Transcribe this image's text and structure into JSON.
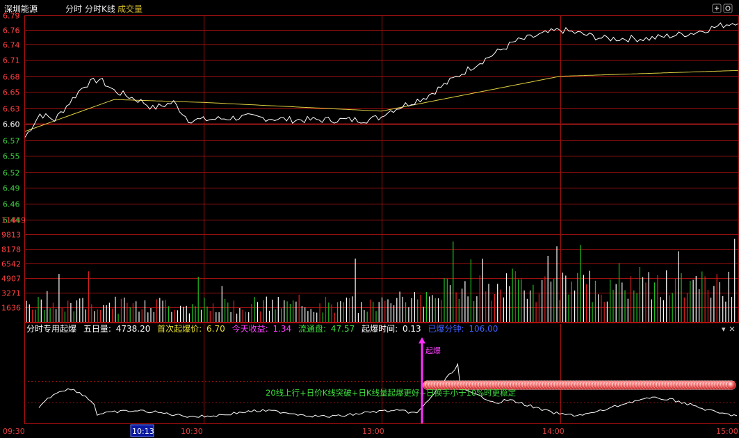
{
  "header": {
    "stock_name": "深圳能源",
    "menu_intraday": "分时",
    "menu_kline": "分时K线",
    "menu_volume": "成交量",
    "colors": {
      "stock_name": "#ffffff",
      "menu": "#e6e6e6",
      "volume_menu": "#d8c030"
    }
  },
  "window_controls": [
    {
      "name": "add-icon",
      "glyph": "+"
    },
    {
      "name": "settings-icon",
      "glyph": "⚙"
    },
    {
      "name": "close-icon",
      "glyph": "×"
    }
  ],
  "price_axis": {
    "labels": [
      "6.79",
      "6.76",
      "6.74",
      "6.71",
      "6.68",
      "6.65",
      "6.63",
      "6.60",
      "6.57",
      "6.55",
      "6.52",
      "6.49",
      "6.46",
      "6.44"
    ],
    "values": [
      6.79,
      6.765,
      6.74,
      6.713,
      6.685,
      6.658,
      6.63,
      6.603,
      6.575,
      6.548,
      6.52,
      6.493,
      6.466,
      6.438
    ],
    "prev_close": 6.603
  },
  "volume_axis": {
    "labels": [
      "11449",
      "9813",
      "8178",
      "6542",
      "4907",
      "3271",
      "1636"
    ],
    "values": [
      11449,
      9813,
      8178,
      6542,
      4907,
      3271,
      1636
    ]
  },
  "indicator": {
    "name": "分时专用起爆",
    "five_day_label": "五日量:",
    "five_day_value": "4738.20",
    "first_price_label": "首次起爆价:",
    "first_price_value": "6.70",
    "today_gain_label": "今天收益:",
    "today_gain_value": "1.34",
    "float_label": "流通盘:",
    "float_value": "47.57",
    "time_label": "起爆时间:",
    "time_value": "0.13",
    "elapsed_label": "已爆分钟:",
    "elapsed_value": "106.00",
    "signal_label": "起爆",
    "annotation": "20线上行+日价K线突破+日K线量起爆更好+日换手小于10%时更稳定",
    "dropdown": "▾",
    "colors": {
      "name": "#ffffff",
      "five": "#ffffff",
      "first": "#e8e030",
      "gain": "#ff40ff",
      "float": "#40e040",
      "time": "#ffffff",
      "elapsed": "#4060ff",
      "annotation": "#40e040",
      "signal": "#ff40ff"
    }
  },
  "time_axis": {
    "labels": [
      "09:30",
      "10:30",
      "13:00",
      "14:00",
      "15:00"
    ],
    "cursor_label": "10:13"
  },
  "chart_data": {
    "type": "line",
    "title": "深圳能源 分时",
    "x_sessions": [
      "09:30-11:30",
      "13:00-15:00"
    ],
    "price_series_sampled": [
      {
        "t": "09:30",
        "price": 6.58
      },
      {
        "t": "09:35",
        "price": 6.62
      },
      {
        "t": "09:40",
        "price": 6.61
      },
      {
        "t": "09:45",
        "price": 6.64
      },
      {
        "t": "09:50",
        "price": 6.67
      },
      {
        "t": "09:55",
        "price": 6.68
      },
      {
        "t": "10:00",
        "price": 6.66
      },
      {
        "t": "10:05",
        "price": 6.65
      },
      {
        "t": "10:10",
        "price": 6.64
      },
      {
        "t": "10:13",
        "price": 6.63
      },
      {
        "t": "10:20",
        "price": 6.64
      },
      {
        "t": "10:25",
        "price": 6.61
      },
      {
        "t": "10:30",
        "price": 6.61
      },
      {
        "t": "10:45",
        "price": 6.615
      },
      {
        "t": "11:00",
        "price": 6.61
      },
      {
        "t": "11:15",
        "price": 6.61
      },
      {
        "t": "11:25",
        "price": 6.61
      },
      {
        "t": "11:30",
        "price": 6.615
      },
      {
        "t": "13:00",
        "price": 6.62
      },
      {
        "t": "13:15",
        "price": 6.65
      },
      {
        "t": "13:30",
        "price": 6.7
      },
      {
        "t": "13:45",
        "price": 6.745
      },
      {
        "t": "14:00",
        "price": 6.765
      },
      {
        "t": "14:15",
        "price": 6.75
      },
      {
        "t": "14:30",
        "price": 6.75
      },
      {
        "t": "14:45",
        "price": 6.76
      },
      {
        "t": "15:00",
        "price": 6.78
      }
    ],
    "avg_price_series_sampled": [
      {
        "t": "09:30",
        "price": 6.59
      },
      {
        "t": "10:00",
        "price": 6.645
      },
      {
        "t": "10:30",
        "price": 6.64
      },
      {
        "t": "11:30",
        "price": 6.625
      },
      {
        "t": "13:00",
        "price": 6.625
      },
      {
        "t": "13:30",
        "price": 6.655
      },
      {
        "t": "14:00",
        "price": 6.685
      },
      {
        "t": "14:30",
        "price": 6.69
      },
      {
        "t": "15:00",
        "price": 6.695
      }
    ],
    "ylim": [
      6.438,
      6.79
    ],
    "volume_ylim": [
      0,
      11449
    ],
    "signal_time": "13:35",
    "signal_price": 6.7
  }
}
